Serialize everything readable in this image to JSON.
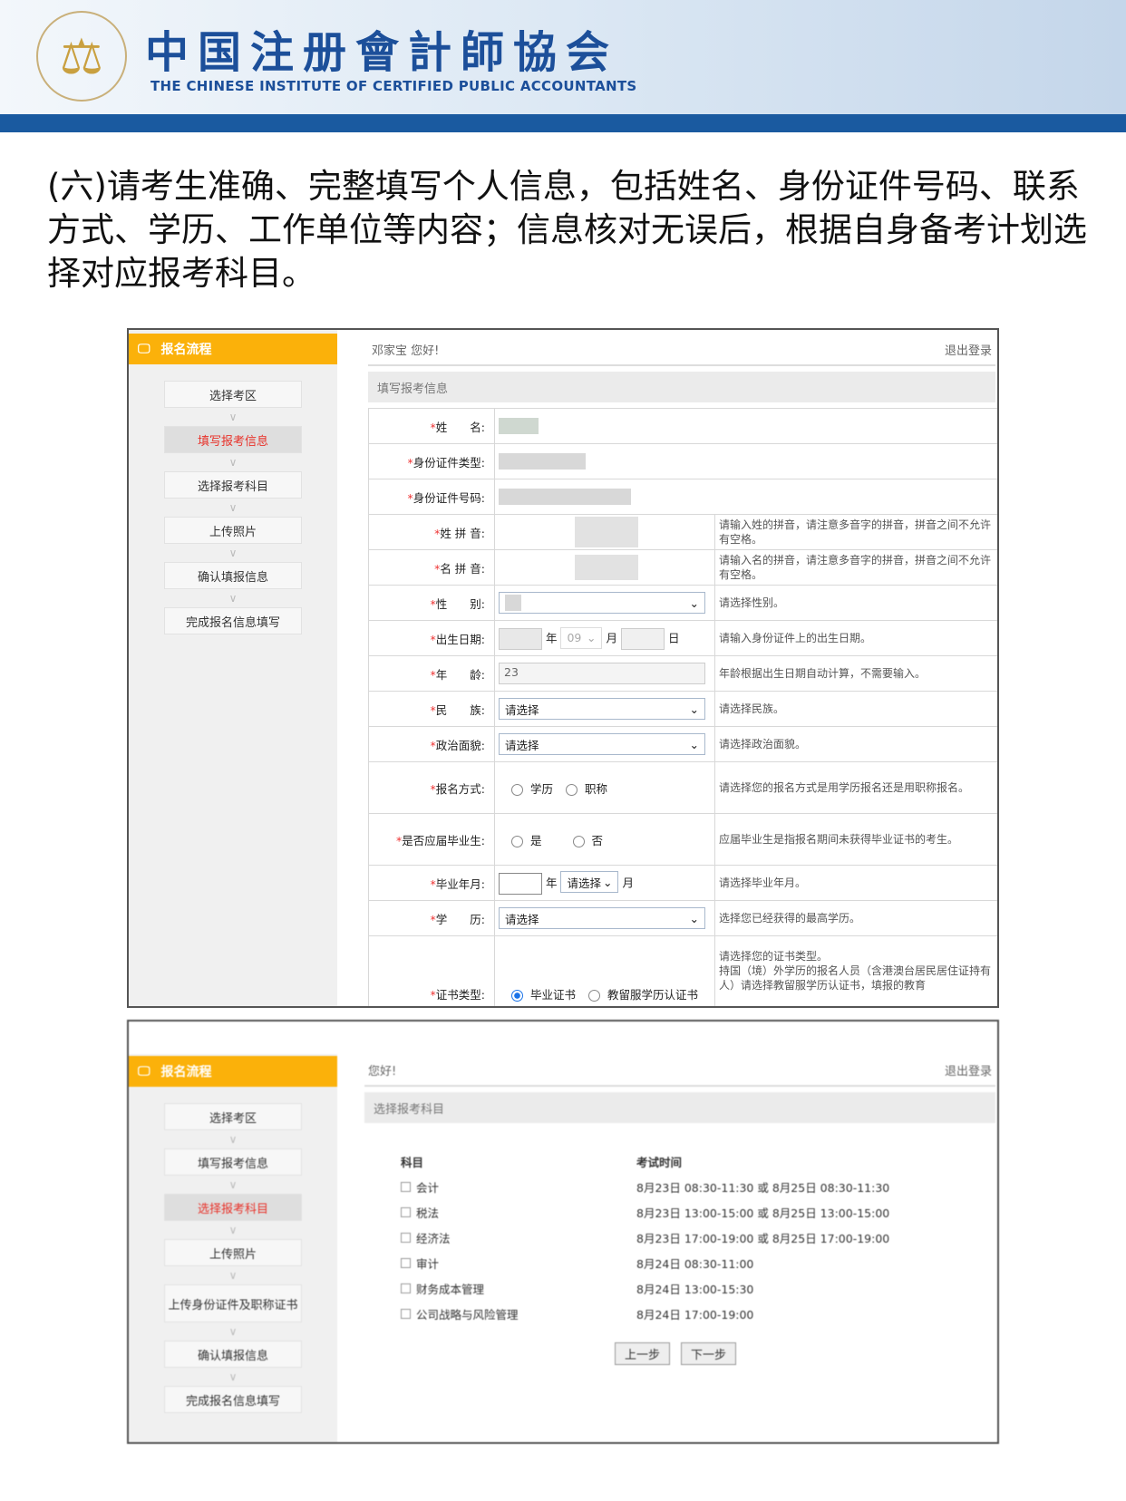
{
  "header": {
    "title_cn": "中国注册會計師協会",
    "title_en": "THE CHINESE INSTITUTE OF CERTIFIED PUBLIC ACCOUNTANTS",
    "brand_color": "#1a5aa0"
  },
  "intro": "(六)请考生准确、完整填写个人信息，包括姓名、身份证件号码、联系方式、学历、工作单位等内容；信息核对无误后，根据自身备考计划选择对应报考科目。",
  "shot1": {
    "sidebar": {
      "title": "报名流程",
      "steps": [
        "选择考区",
        "填写报考信息",
        "选择报考科目",
        "上传照片",
        "确认填报信息",
        "完成报名信息填写"
      ],
      "active": 1
    },
    "greeting": "邓家宝 您好!",
    "logout": "退出登录",
    "section": "填写报考信息",
    "fields": [
      {
        "label": "姓　　名:"
      },
      {
        "label": "身份证件类型:"
      },
      {
        "label": "身份证件号码:"
      },
      {
        "label": "姓 拼 音:",
        "hint": "请输入姓的拼音，请注意多音字的拼音，拼音之间不允许有空格。"
      },
      {
        "label": "名 拼 音:",
        "hint": "请输入名的拼音，请注意多音字的拼音，拼音之间不允许有空格。"
      },
      {
        "label": "性　　别:",
        "hint": "请选择性别。"
      },
      {
        "label": "出生日期:",
        "hint": "请输入身份证件上的出生日期。",
        "year_unit": "年",
        "month": "09",
        "month_unit": "月",
        "day_unit": "日"
      },
      {
        "label": "年　　龄:",
        "value": "23",
        "hint": "年龄根据出生日期自动计算，不需要输入。"
      },
      {
        "label": "民　　族:",
        "value": "请选择",
        "hint": "请选择民族。"
      },
      {
        "label": "政治面貌:",
        "value": "请选择",
        "hint": "请选择政治面貌。"
      },
      {
        "label": "报名方式:",
        "options": [
          "学历",
          "职称"
        ],
        "hint": "请选择您的报名方式是用学历报名还是用职称报名。"
      },
      {
        "label": "是否应届毕业生:",
        "options": [
          "是",
          "否"
        ],
        "hint": "应届毕业生是指报名期间未获得毕业证书的考生。"
      },
      {
        "label": "毕业年月:",
        "year_unit": "年",
        "month": "请选择",
        "month_unit": "月",
        "hint": "请选择毕业年月。"
      },
      {
        "label": "学　　历:",
        "value": "请选择",
        "hint": "选择您已经获得的最高学历。"
      },
      {
        "label": "证书类型:",
        "options": [
          "毕业证书",
          "教留服学历认证书"
        ],
        "hint": "请选择您的证书类型。",
        "hint2": "持国（境）外学历的报名人员（含港澳台居民居住证持有人）请选择教留服学历认证书，填报的教育"
      }
    ]
  },
  "shot2": {
    "sidebar": {
      "title": "报名流程",
      "steps": [
        "选择考区",
        "填写报考信息",
        "选择报考科目",
        "上传照片",
        "上传身份证件及职称证书",
        "确认填报信息",
        "完成报名信息填写"
      ],
      "active": 2
    },
    "greeting": "您好!",
    "logout": "退出登录",
    "section": "选择报考科目",
    "col_subject": "科目",
    "col_time": "考试时间",
    "subjects": [
      {
        "name": "会计",
        "time": "8月23日 08:30-11:30 或 8月25日 08:30-11:30"
      },
      {
        "name": "税法",
        "time": "8月23日 13:00-15:00 或 8月25日 13:00-15:00"
      },
      {
        "name": "经济法",
        "time": "8月23日 17:00-19:00 或 8月25日 17:00-19:00"
      },
      {
        "name": "审计",
        "time": "8月24日 08:30-11:00"
      },
      {
        "name": "财务成本管理",
        "time": "8月24日 13:00-15:30"
      },
      {
        "name": "公司战略与风险管理",
        "time": "8月24日 17:00-19:00"
      }
    ],
    "prev": "上一步",
    "next": "下一步"
  }
}
